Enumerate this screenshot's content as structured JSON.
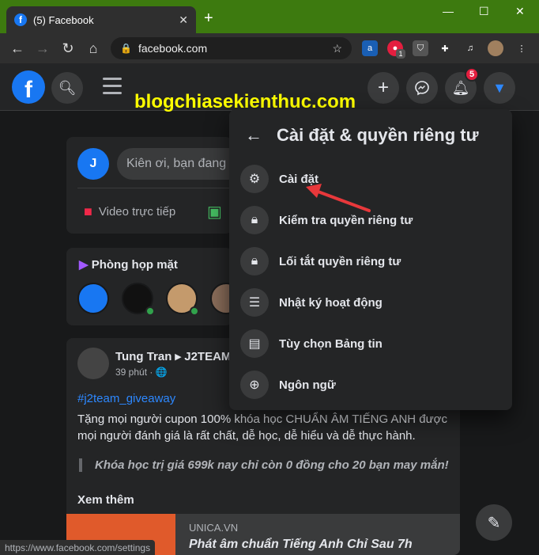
{
  "browser": {
    "tab_title": "(5) Facebook",
    "url": "facebook.com",
    "status_url": "https://www.facebook.com/settings",
    "ext_badge": "1"
  },
  "header": {
    "notification_count": "5",
    "watermark": "blogchiasekienthuc.com"
  },
  "composer": {
    "placeholder": "Kiên ơi, bạn đang",
    "live_video_label": "Video trực tiếp"
  },
  "rooms": {
    "title": "Phòng họp mặt"
  },
  "post": {
    "author": "Tung Tran ▸ J2TEAM",
    "time": "39 phút · 🌐",
    "hashtag": "#j2team_giveaway",
    "body": "Tặng mọi người cupon 100% khóa học CHUẨN ÂM TIẾNG ANH được mọi người đánh giá là rất chất, dễ học, dễ hiểu và dễ thực hành.",
    "quote": "Khóa học trị giá 699k nay chỉ còn 0 đồng cho 20 bạn may mắn!",
    "see_more": "Xem thêm",
    "link_source": "UNICA.VN",
    "link_title": "Phát âm chuẩn Tiếng Anh Chỉ Sau 7h"
  },
  "menu": {
    "title": "Cài đặt & quyền riêng tư",
    "items": [
      {
        "label": "Cài đặt",
        "icon": "gear-icon"
      },
      {
        "label": "Kiểm tra quyền riêng tư",
        "icon": "lock-heart-icon"
      },
      {
        "label": "Lối tắt quyền riêng tư",
        "icon": "lock-icon"
      },
      {
        "label": "Nhật ký hoạt động",
        "icon": "list-icon"
      },
      {
        "label": "Tùy chọn Bảng tin",
        "icon": "feed-icon"
      },
      {
        "label": "Ngôn ngữ",
        "icon": "globe-icon"
      }
    ]
  },
  "colors": {
    "brand": "#1877f2",
    "browser_frame": "#3d7a0f",
    "arrow": "#e8383b"
  }
}
